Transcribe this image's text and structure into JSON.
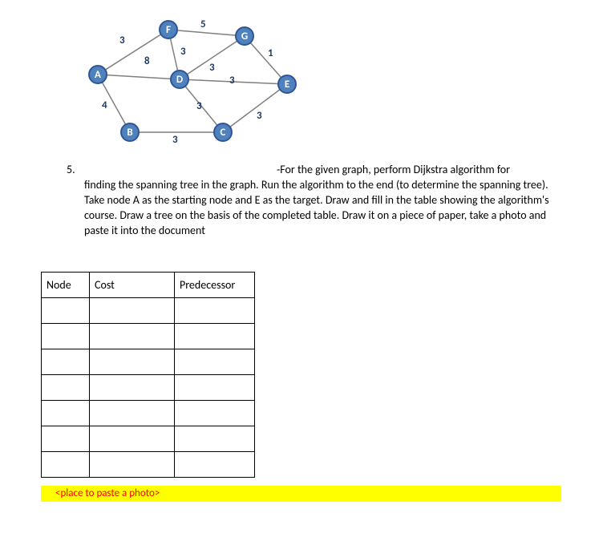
{
  "question_number": "5.",
  "question_lead": "-For the given graph, perform Dijkstra algorithm for",
  "question_rest": "finding the spanning tree in the graph. Run the algorithm to the end (to determine the spanning tree). Take node A as the starting node and E as the target. Draw and fill in the table showing the algorithm's course. Draw a tree on the basis of the completed table. Draw it on a piece of paper, take a photo and paste it into the document",
  "graph": {
    "nodes": {
      "A": "A",
      "B": "B",
      "C": "C",
      "D": "D",
      "E": "E",
      "F": "F",
      "G": "G"
    },
    "edges": {
      "AF": "3",
      "AD": "8",
      "AB": "4",
      "FD": "3",
      "FG": "5",
      "DG": "3",
      "DC": "3",
      "DE": "3",
      "GE": "1",
      "BC": "3",
      "CE": "3"
    }
  },
  "table": {
    "headers": {
      "node": "Node",
      "cost": "Cost",
      "pred": "Predecessor"
    }
  },
  "photo_placeholder": "<place to paste a photo>"
}
